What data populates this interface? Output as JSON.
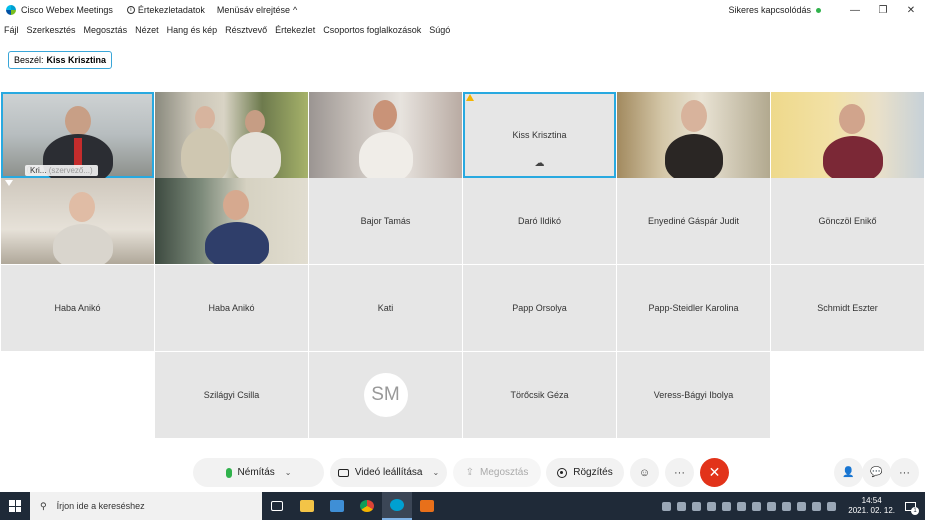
{
  "window": {
    "app_title": "Cisco Webex Meetings",
    "meeting_info": "Értekezletadatok",
    "menu_toggle": "Menüsáv elrejtése",
    "connection_status": "Sikeres kapcsolódás",
    "minimize": "—",
    "restore": "❐",
    "close": "✕"
  },
  "menu": {
    "items": [
      "Fájl",
      "Szerkesztés",
      "Megosztás",
      "Nézet",
      "Hang és kép",
      "Résztvevő",
      "Értekezlet",
      "Csoportos foglalkozások",
      "Súgó"
    ]
  },
  "speaker": {
    "prefix": "Beszél:",
    "name": "Kiss Krisztina"
  },
  "tiles": {
    "host": {
      "name": "Kri...",
      "role": "(szervező...)"
    },
    "active_speaker": {
      "name": "Kiss Krisztina"
    },
    "names": {
      "bajor": "Bajor Tamás",
      "daro": "Daró Ildikó",
      "enyedine": "Enyediné Gáspár Judit",
      "gonczol": "Gönczöl Enikő",
      "haba1": "Haba Anikó",
      "haba2": "Haba Anikó",
      "kati": "Kati",
      "papp_o": "Papp Orsolya",
      "papp_s": "Papp-Steidler Karolina",
      "schmidt": "Schmidt Eszter",
      "szilagyi": "Szilágyi Csilla",
      "sm_initials": "SM",
      "torocsik": "Törőcsik Géza",
      "veress": "Veress-Bágyi Ibolya"
    }
  },
  "controls": {
    "mute": "Némítás",
    "video": "Videó leállítása",
    "share": "Megosztás",
    "record": "Rögzítés",
    "more": "···",
    "end": "✕",
    "emoji": "☺",
    "participants": "👤",
    "chat": "💬",
    "more_right": "···",
    "caret": "⌄"
  },
  "taskbar": {
    "search_placeholder": "Írjon ide a kereséshez",
    "time": "14:54",
    "date": "2021. 02. 12.",
    "notif_count": "1"
  },
  "colors": {
    "accent": "#28a9e0",
    "end_call": "#e2331a",
    "mic_active": "#30b24c",
    "taskbar": "#1f2a38"
  }
}
